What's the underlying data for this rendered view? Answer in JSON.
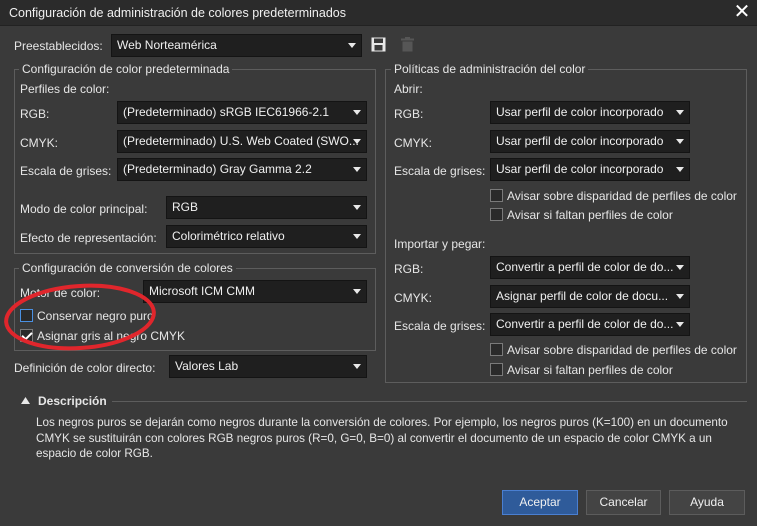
{
  "window": {
    "title": "Configuración de administración de colores predeterminados",
    "close_glyph": "✕"
  },
  "presets": {
    "label": "Preestablecidos:",
    "value": "Web Norteamérica",
    "save_icon": "save-icon",
    "delete_icon": "trash-icon"
  },
  "default_color": {
    "title": "Configuración de color predeterminada",
    "profiles_label": "Perfiles de color:",
    "rgb_label": "RGB:",
    "rgb_value": "(Predeterminado) sRGB IEC61966-2.1",
    "cmyk_label": "CMYK:",
    "cmyk_value": "(Predeterminado) U.S. Web Coated (SWO...",
    "gray_label": "Escala de grises:",
    "gray_value": "(Predeterminado) Gray Gamma 2.2",
    "primary_mode_label": "Modo de color principal:",
    "primary_mode_value": "RGB",
    "rendering_label": "Efecto de representación:",
    "rendering_value": "Colorimétrico relativo"
  },
  "conversion": {
    "title": "Configuración de conversión de colores",
    "engine_label": "Motor de color:",
    "engine_value": "Microsoft ICM CMM",
    "preserve_black_label": "Conservar negro puro",
    "preserve_black_checked": false,
    "gray_to_black_label": "Asignar gris al negro CMYK",
    "gray_to_black_checked": true
  },
  "direct_color": {
    "label": "Definición de color directo:",
    "value": "Valores Lab"
  },
  "policies": {
    "title": "Políticas de administración del color",
    "open_label": "Abrir:",
    "open_rgb_label": "RGB:",
    "open_rgb_value": "Usar perfil de color incorporado",
    "open_cmyk_label": "CMYK:",
    "open_cmyk_value": "Usar perfil de color incorporado",
    "open_gray_label": "Escala de grises:",
    "open_gray_value": "Usar perfil de color incorporado",
    "open_warn_mismatch": "Avisar sobre disparidad de perfiles de color",
    "open_warn_missing": "Avisar si faltan perfiles de color",
    "import_label": "Importar y pegar:",
    "import_rgb_label": "RGB:",
    "import_rgb_value": "Convertir a perfil de color de do...",
    "import_cmyk_label": "CMYK:",
    "import_cmyk_value": "Asignar perfil de color de docu...",
    "import_gray_label": "Escala de grises:",
    "import_gray_value": "Convertir a perfil de color de do...",
    "import_warn_mismatch": "Avisar sobre disparidad de perfiles de color",
    "import_warn_missing": "Avisar si faltan perfiles de color"
  },
  "description": {
    "title": "Descripción",
    "text": "Los negros puros se dejarán como negros durante la conversión de colores. Por ejemplo, los negros puros (K=100) en un documento CMYK se sustituirán con colores RGB negros puros (R=0, G=0, B=0) al convertir el documento de un espacio de color CMYK a un espacio de color RGB."
  },
  "buttons": {
    "ok": "Aceptar",
    "cancel": "Cancelar",
    "help": "Ayuda"
  },
  "colors": {
    "accent": "#2f5b9a",
    "annotation_circle": "#e0262c"
  }
}
